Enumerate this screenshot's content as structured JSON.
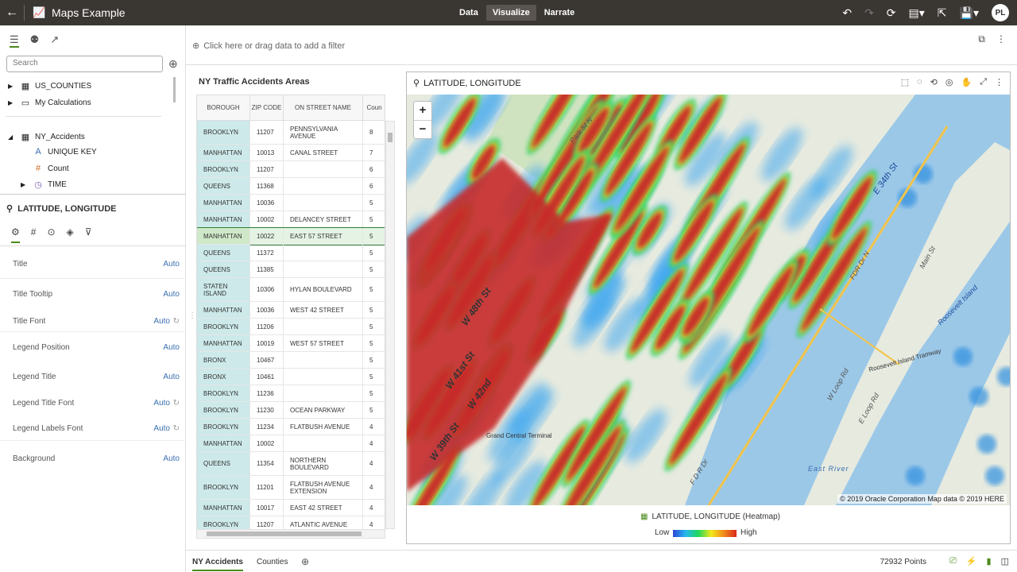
{
  "app": {
    "title": "Maps Example",
    "back_icon": "back-arrow-icon",
    "user_initials": "PL"
  },
  "modes": [
    {
      "label": "Data"
    },
    {
      "label": "Visualize"
    },
    {
      "label": "Narrate"
    }
  ],
  "active_mode": "Visualize",
  "left": {
    "search_placeholder": "Search",
    "tree": [
      {
        "label": "US_COUNTIES"
      },
      {
        "label": "My Calculations"
      },
      {
        "label": "NY_Accidents"
      },
      {
        "label": "UNIQUE KEY"
      },
      {
        "label": "Count"
      },
      {
        "label": "TIME"
      }
    ],
    "properties_title": "LATITUDE, LONGITUDE",
    "properties": [
      {
        "label": "Title",
        "value": "Auto"
      },
      {
        "label": "Title Tooltip",
        "value": "Auto"
      },
      {
        "label": "Title Font",
        "value": "Auto"
      },
      {
        "label": "Legend Position",
        "value": "Auto"
      },
      {
        "label": "Legend Title",
        "value": "Auto"
      },
      {
        "label": "Legend Title Font",
        "value": "Auto"
      },
      {
        "label": "Legend Labels Font",
        "value": "Auto"
      },
      {
        "label": "Background",
        "value": "Auto"
      }
    ]
  },
  "filter": {
    "hint": "Click here or drag data to add a filter"
  },
  "table": {
    "title": "NY Traffic Accidents Areas",
    "columns": [
      "BOROUGH",
      "ZIP CODE",
      "ON STREET NAME",
      "Coun"
    ],
    "rows": [
      [
        "BROOKLYN",
        "11207",
        "PENNSYLVANIA AVENUE",
        "8"
      ],
      [
        "MANHATTAN",
        "10013",
        "CANAL STREET",
        "7"
      ],
      [
        "BROOKLYN",
        "11207",
        "",
        "6"
      ],
      [
        "QUEENS",
        "11368",
        "",
        "6"
      ],
      [
        "MANHATTAN",
        "10036",
        "",
        "5"
      ],
      [
        "MANHATTAN",
        "10002",
        "DELANCEY STREET",
        "5"
      ],
      [
        "MANHATTAN",
        "10022",
        "EAST 57 STREET",
        "5"
      ],
      [
        "QUEENS",
        "11372",
        "",
        "5"
      ],
      [
        "QUEENS",
        "11385",
        "",
        "5"
      ],
      [
        "STATEN ISLAND",
        "10306",
        "HYLAN BOULEVARD",
        "5"
      ],
      [
        "MANHATTAN",
        "10036",
        "WEST 42 STREET",
        "5"
      ],
      [
        "BROOKLYN",
        "11206",
        "",
        "5"
      ],
      [
        "MANHATTAN",
        "10019",
        "WEST 57 STREET",
        "5"
      ],
      [
        "BRONX",
        "10467",
        "",
        "5"
      ],
      [
        "BRONX",
        "10461",
        "",
        "5"
      ],
      [
        "BROOKLYN",
        "11236",
        "",
        "5"
      ],
      [
        "BROOKLYN",
        "11230",
        "OCEAN PARKWAY",
        "5"
      ],
      [
        "BROOKLYN",
        "11234",
        "FLATBUSH AVENUE",
        "4"
      ],
      [
        "MANHATTAN",
        "10002",
        "",
        "4"
      ],
      [
        "QUEENS",
        "11354",
        "NORTHERN BOULEVARD",
        "4"
      ],
      [
        "BROOKLYN",
        "11201",
        "FLATBUSH AVENUE EXTENSION",
        "4"
      ],
      [
        "MANHATTAN",
        "10017",
        "EAST 42 STREET",
        "4"
      ],
      [
        "BROOKLYN",
        "11207",
        "ATLANTIC AVENUE",
        "4"
      ]
    ],
    "selected_row": 6
  },
  "map": {
    "title": "LATITUDE, LONGITUDE",
    "zoom_in": "+",
    "zoom_out": "−",
    "attribution": "© 2019 Oracle Corporation   Map data © 2019 HERE",
    "place_labels": [
      "Roosevelt Island Tramway",
      "East River",
      "Grand Central Terminal",
      "Park St N",
      "W 48th St",
      "W 42nd",
      "W 41st St",
      "W 39th St",
      "E 34th St",
      "F D R Dr",
      "FDR Dr N",
      "Main St",
      "Roosevelt Island",
      "E Loop Rd",
      "W Loop Rd"
    ],
    "legend_title": "LATITUDE, LONGITUDE (Heatmap)",
    "legend_low": "Low",
    "legend_high": "High",
    "colors": {
      "water": "#9cc8e8",
      "land": "#e8ece0",
      "hot": "#c62a2a"
    }
  },
  "bottom": {
    "tabs": [
      {
        "label": "NY Accidents"
      },
      {
        "label": "Counties"
      }
    ],
    "points": "72932 Points"
  }
}
